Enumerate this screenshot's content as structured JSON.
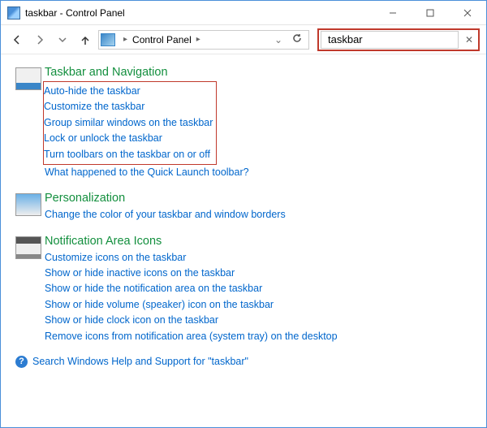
{
  "window": {
    "title": "taskbar - Control Panel"
  },
  "nav": {
    "address_segment": "Control Panel",
    "search_value": "taskbar"
  },
  "sections": {
    "taskbar": {
      "title": "Taskbar and Navigation",
      "boxed": [
        "Auto-hide the taskbar",
        "Customize the taskbar",
        "Group similar windows on the taskbar",
        "Lock or unlock the taskbar",
        "Turn toolbars on the taskbar on or off"
      ],
      "extra": "What happened to the Quick Launch toolbar?"
    },
    "personalization": {
      "title": "Personalization",
      "links": [
        "Change the color of your taskbar and window borders"
      ]
    },
    "notification": {
      "title": "Notification Area Icons",
      "links": [
        "Customize icons on the taskbar",
        "Show or hide inactive icons on the taskbar",
        "Show or hide the notification area on the taskbar",
        "Show or hide volume (speaker) icon on the taskbar",
        "Show or hide clock icon on the taskbar",
        "Remove icons from notification area (system tray) on the desktop"
      ]
    }
  },
  "help": {
    "text": "Search Windows Help and Support for \"taskbar\""
  }
}
